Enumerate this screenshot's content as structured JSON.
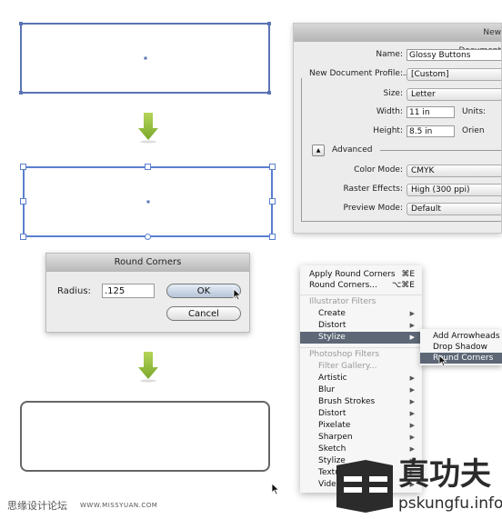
{
  "new_document_dialog": {
    "title": "New Document",
    "name_label": "Name:",
    "name_value": "Glossy Buttons",
    "profile_label": "New Document Profile:",
    "profile_value": "[Custom]",
    "size_label": "Size:",
    "size_value": "Letter",
    "width_label": "Width:",
    "width_value": "11 in",
    "units_label": "Units:",
    "height_label": "Height:",
    "height_value": "8.5 in",
    "orientation_label": "Orien",
    "advanced_label": "Advanced",
    "color_mode_label": "Color Mode:",
    "color_mode_value": "CMYK",
    "raster_label": "Raster Effects:",
    "raster_value": "High (300 ppi)",
    "preview_label": "Preview Mode:",
    "preview_value": "Default"
  },
  "round_corners_dialog": {
    "title": "Round Corners",
    "radius_label": "Radius:",
    "radius_value": ".125",
    "ok_label": "OK",
    "cancel_label": "Cancel"
  },
  "effect_menu": {
    "items": [
      {
        "label": "Apply Round Corners",
        "shortcut": "⌘E"
      },
      {
        "label": "Round Corners...",
        "shortcut": "⌥⌘E"
      },
      {
        "label": "Illustrator Filters",
        "header": true
      },
      {
        "label": "Create",
        "submenu": true
      },
      {
        "label": "Distort",
        "submenu": true
      },
      {
        "label": "Stylize",
        "submenu": true,
        "highlighted": true
      },
      {
        "label": "Photoshop Filters",
        "header": true
      },
      {
        "label": "Filter Gallery...",
        "disabled": true
      },
      {
        "label": "Artistic",
        "submenu": true
      },
      {
        "label": "Blur",
        "submenu": true
      },
      {
        "label": "Brush Strokes",
        "submenu": true
      },
      {
        "label": "Distort",
        "submenu": true
      },
      {
        "label": "Pixelate",
        "submenu": true
      },
      {
        "label": "Sharpen",
        "submenu": true
      },
      {
        "label": "Sketch",
        "submenu": true
      },
      {
        "label": "Stylize",
        "submenu": true
      },
      {
        "label": "Texture",
        "submenu": true
      },
      {
        "label": "Video",
        "submenu": true
      }
    ],
    "stylize_submenu": [
      {
        "label": "Add Arrowheads"
      },
      {
        "label": "Drop Shadow"
      },
      {
        "label": "Round Corners",
        "highlighted": true
      }
    ]
  },
  "watermark": {
    "site_cn": "思缘设计论坛",
    "site_url": "WWW.MISSYUAN.COM",
    "logo_cn": "真功夫",
    "logo_url": "pskungfu.info"
  },
  "colors": {
    "selection_blue": "#5a74b5",
    "arrow_green": "#8dbb2e",
    "menu_highlight": "#5d6776"
  }
}
